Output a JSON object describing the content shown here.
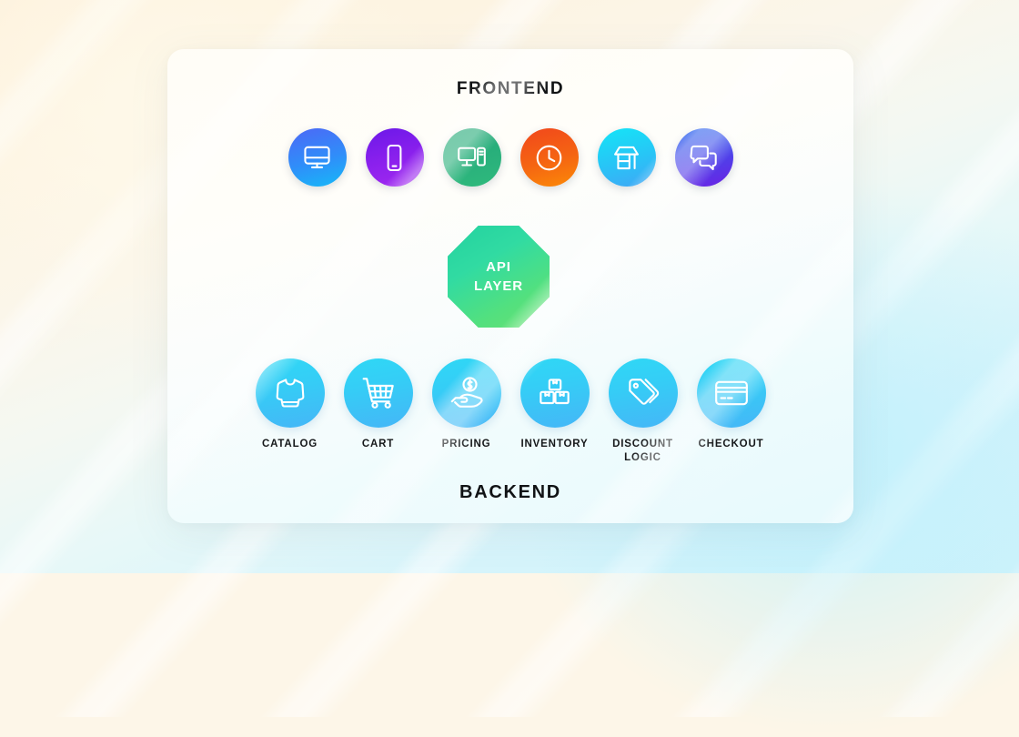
{
  "background": {
    "top_color": "#fdf1dc",
    "bottom_color": "#cdf2fb"
  },
  "card": {
    "background_color": "#fffdf7"
  },
  "frontend": {
    "title": "FRONTEND",
    "nodes": [
      {
        "icon": "desktop-monitor-icon",
        "gradient_from": "#4d68f6",
        "gradient_to": "#16b9f8"
      },
      {
        "icon": "mobile-phone-icon",
        "gradient_from": "#6b18e8",
        "gradient_to": "#a329f0"
      },
      {
        "icon": "desktop-tower-icon",
        "gradient_from": "#23a877",
        "gradient_to": "#2fba7d"
      },
      {
        "icon": "clock-icon",
        "gradient_from": "#f1471c",
        "gradient_to": "#fb8a07"
      },
      {
        "icon": "storefront-icon",
        "gradient_from": "#14e5f7",
        "gradient_to": "#41a6f5"
      },
      {
        "icon": "chat-bubbles-icon",
        "gradient_from": "#2a6df0",
        "gradient_to": "#6b22e4"
      }
    ]
  },
  "api_layer": {
    "line1": "API",
    "line2": "LAYER",
    "shape": "octagon",
    "gradient_from": "#23d2a0",
    "gradient_to": "#69e272"
  },
  "backend": {
    "title": "BACKEND",
    "circle_gradient_from": "#2fd8f5",
    "circle_gradient_to": "#45b6f7",
    "nodes": [
      {
        "label": "CATALOG",
        "icon": "sweater-icon"
      },
      {
        "label": "CART",
        "icon": "shopping-cart-icon"
      },
      {
        "label": "PRICING",
        "icon": "hand-holding-coin-icon"
      },
      {
        "label": "INVENTORY",
        "icon": "boxes-icon"
      },
      {
        "label": "DISCOUNT\nLOGIC",
        "icon": "price-tags-icon"
      },
      {
        "label": "CHECKOUT",
        "icon": "credit-card-icon"
      }
    ]
  }
}
